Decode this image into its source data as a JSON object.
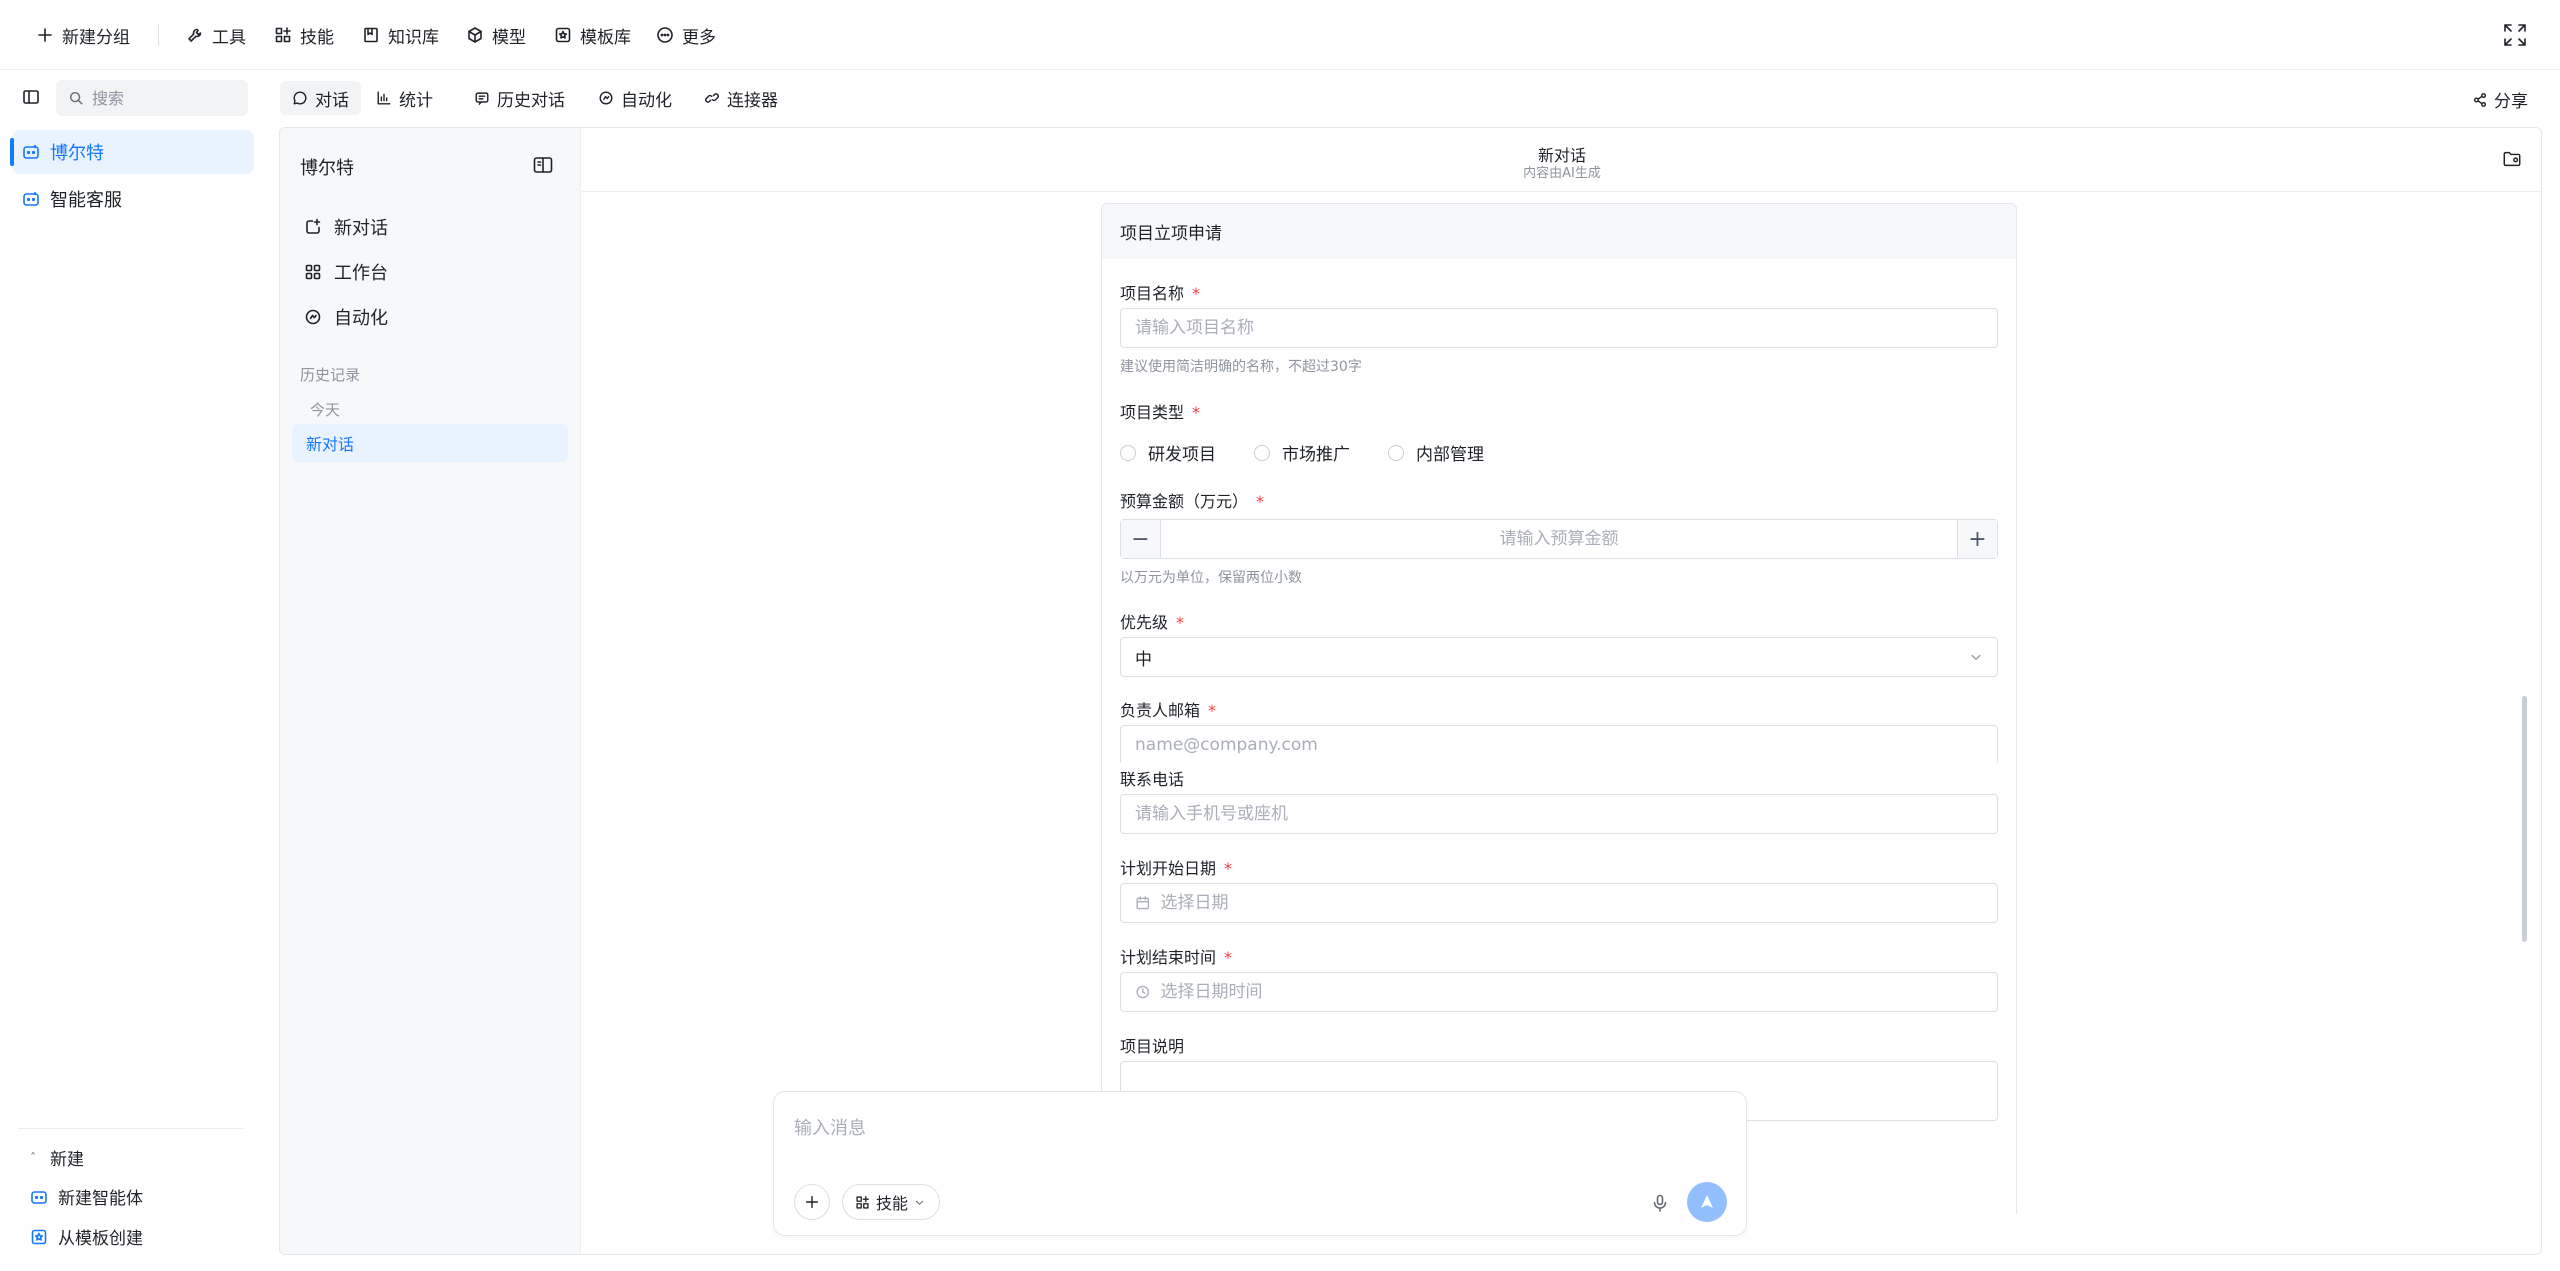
{
  "topbar": {
    "new_group": "新建分组",
    "tools": "工具",
    "skills": "技能",
    "knowledge": "知识库",
    "models": "模型",
    "templates": "模板库",
    "more": "更多"
  },
  "sidebar": {
    "search_placeholder": "搜索",
    "agents": [
      {
        "label": "博尔特",
        "active": true
      },
      {
        "label": "智能客服",
        "active": false
      }
    ],
    "bottom": {
      "new_label": "新建",
      "new_agent": "新建智能体",
      "from_template": "从模板创建"
    }
  },
  "subtabs": {
    "chat": "对话",
    "stats": "统计",
    "history": "历史对话",
    "automation": "自动化",
    "connectors": "连接器",
    "share": "分享"
  },
  "convpanel": {
    "title": "博尔特",
    "new_chat": "新对话",
    "workbench": "工作台",
    "automation": "自动化",
    "history_label": "历史记录",
    "today_label": "今天",
    "history_items": [
      "新对话"
    ]
  },
  "chat": {
    "title": "新对话",
    "subtitle": "内容由AI生成"
  },
  "form": {
    "title": "项目立项申请",
    "name_label": "项目名称",
    "name_placeholder": "请输入项目名称",
    "name_hint": "建议使用简洁明确的名称，不超过30字",
    "type_label": "项目类型",
    "type_options": [
      "研发项目",
      "市场推广",
      "内部管理"
    ],
    "budget_label": "预算金额（万元）",
    "budget_placeholder": "请输入预算金额",
    "budget_hint": "以万元为单位，保留两位小数",
    "priority_label": "优先级",
    "priority_value": "中",
    "email_label": "负责人邮箱",
    "email_placeholder": "name@company.com",
    "phone_label": "联系电话",
    "phone_placeholder": "请输入手机号或座机",
    "start_label": "计划开始日期",
    "start_placeholder": "选择日期",
    "end_label": "计划结束时间",
    "end_placeholder": "选择日期时间",
    "desc_label": "项目说明",
    "required_mark": "*",
    "minus": "−",
    "plus": "+"
  },
  "composer": {
    "placeholder": "输入消息",
    "skill_label": "技能"
  }
}
